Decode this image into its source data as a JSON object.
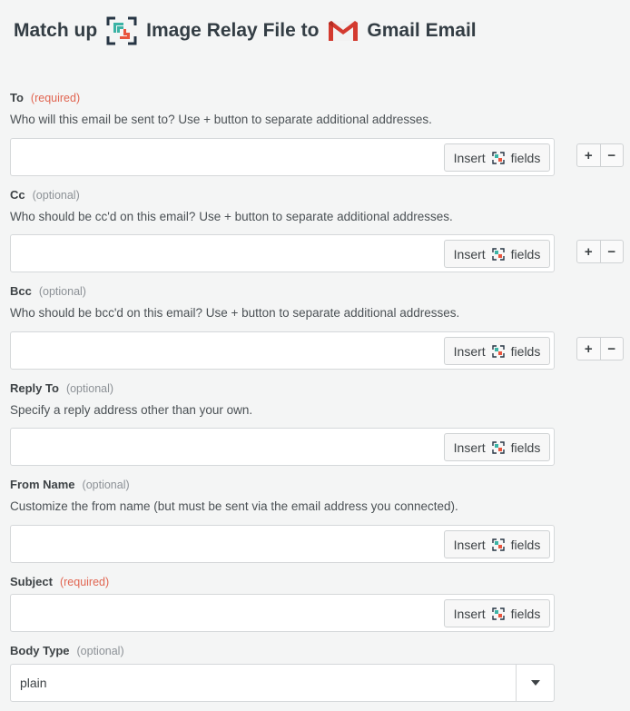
{
  "header": {
    "prefix": "Match up",
    "app_name": "Image Relay File to",
    "target": "Gmail Email",
    "app_icon": "image-relay-logo-icon",
    "target_icon": "gmail-logo-icon"
  },
  "insert_button": {
    "left": "Insert",
    "right": "fields",
    "icon": "image-relay-mini-icon"
  },
  "fields": [
    {
      "label": "To",
      "tag": "(required)",
      "help": "Who will this email be sent to? Use + button to separate additional addresses.",
      "value": ""
    },
    {
      "label": "Cc",
      "tag": "(optional)",
      "help": "Who should be cc'd on this email? Use + button to separate additional addresses.",
      "value": ""
    },
    {
      "label": "Bcc",
      "tag": "(optional)",
      "help": "Who should be bcc'd on this email? Use + button to separate additional addresses.",
      "value": ""
    },
    {
      "label": "Reply To",
      "tag": "(optional)",
      "help": "Specify a reply address other than your own.",
      "value": ""
    },
    {
      "label": "From Name",
      "tag": "(optional)",
      "help": "Customize the from name (but must be sent via the email address you connected).",
      "value": ""
    },
    {
      "label": "Subject",
      "tag": "(required)",
      "value": ""
    },
    {
      "label": "Body Type",
      "tag": "(optional)",
      "value": "plain"
    }
  ],
  "plus_minus": {
    "plus": "+",
    "minus": "−"
  },
  "colors": {
    "required": "#e16652",
    "optional": "#8c9196",
    "background": "#f4f5f5"
  }
}
